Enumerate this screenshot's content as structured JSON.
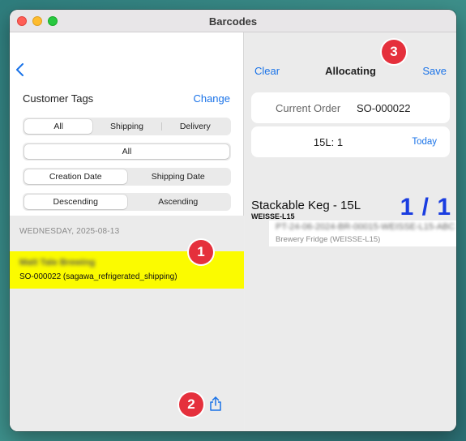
{
  "window": {
    "title": "Barcodes"
  },
  "left": {
    "customer_tags_label": "Customer Tags",
    "change_label": "Change",
    "segments": {
      "type": [
        "All",
        "Shipping",
        "Delivery"
      ],
      "filter": [
        "All"
      ],
      "date": [
        "Creation Date",
        "Shipping Date"
      ],
      "order": [
        "Descending",
        "Ascending"
      ]
    },
    "date_header": "WEDNESDAY, 2025-08-13",
    "order_row": {
      "name_redacted": "Matt Tale Brewing",
      "subtitle": "SO-000022 (sagawa_refrigerated_shipping)"
    }
  },
  "right": {
    "clear_label": "Clear",
    "title": "Allocating",
    "save_label": "Save",
    "current_order_label": "Current Order",
    "current_order_value": "SO-000022",
    "quantity_text": "15L: 1",
    "today_label": "Today",
    "item": {
      "name": "Stackable Keg - 15L",
      "sku": "WEISSE-L15",
      "count": "1 / 1",
      "serial_redacted": "PT-24-06-2024-BR-00015-WEISSE-L15-ABC",
      "location": "Brewery Fridge (WEISSE-L15)"
    }
  },
  "badges": {
    "one": "1",
    "two": "2",
    "three": "3"
  },
  "colors": {
    "accent": "#1a73e8",
    "highlight": "#fbfb00",
    "badge": "#e5303c",
    "count": "#1a3de0"
  }
}
